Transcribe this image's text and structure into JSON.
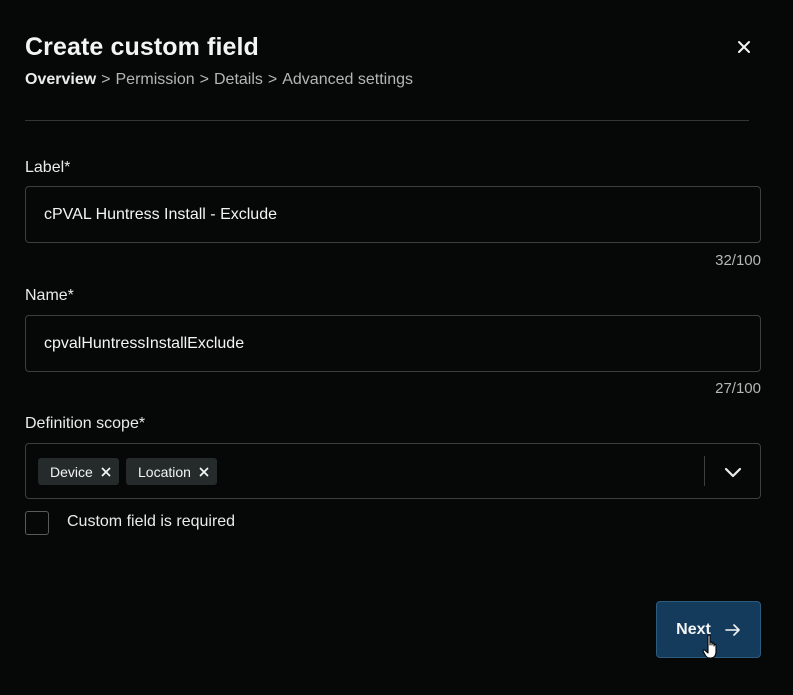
{
  "dialog": {
    "title": "Create custom field",
    "close_icon": "close-icon"
  },
  "breadcrumb": {
    "items": [
      {
        "label": "Overview",
        "active": true
      },
      {
        "label": "Permission",
        "active": false
      },
      {
        "label": "Details",
        "active": false
      },
      {
        "label": "Advanced settings",
        "active": false
      }
    ],
    "separator": ">"
  },
  "fields": {
    "label": {
      "caption": "Label*",
      "value": "cPVAL Huntress Install - Exclude",
      "counter": "32/100"
    },
    "name": {
      "caption": "Name*",
      "value": "cpvalHuntressInstallExclude",
      "counter": "27/100"
    },
    "scope": {
      "caption": "Definition scope*",
      "chips": [
        {
          "label": "Device"
        },
        {
          "label": "Location"
        }
      ],
      "toggle_icon": "chevron-down-icon"
    },
    "required": {
      "label": "Custom field is required",
      "checked": false
    }
  },
  "footer": {
    "next_label": "Next",
    "next_icon": "arrow-right-icon"
  },
  "colors": {
    "background": "#060707",
    "primary_button": "#143a5c",
    "border": "#3a3f3f",
    "muted_text": "#b3b7b6"
  }
}
